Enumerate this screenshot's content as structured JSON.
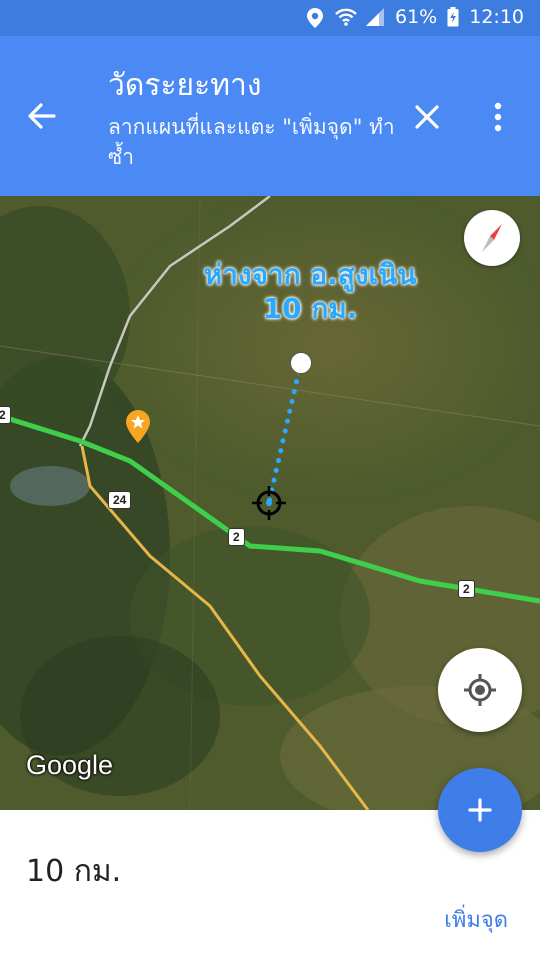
{
  "status_bar": {
    "battery": "61%",
    "time": "12:10",
    "icons": [
      "location-icon",
      "wifi-icon",
      "signal-icon",
      "battery-charging-icon"
    ]
  },
  "app_bar": {
    "title": "วัดระยะทาง",
    "subtitle": "ลากแผนที่และแตะ \"เพิ่มจุด\" ทำซ้ำ",
    "icons": [
      "back-arrow-icon",
      "close-icon",
      "more-vert-icon"
    ]
  },
  "map": {
    "distance_label_line1": "ห่างจาก อ.สูงเนิน",
    "distance_label_line2": "10 กม.",
    "road_shields": [
      "2",
      "24",
      "2",
      "2"
    ],
    "attribution": "Google",
    "icons": [
      "compass-icon",
      "my-location-icon",
      "place-star-icon",
      "crosshair-icon"
    ]
  },
  "bottom_panel": {
    "distance": "10 กม.",
    "add_point": "เพิ่มจุด",
    "fab_icon": "add-icon"
  },
  "colors": {
    "app_bar": "#4b8af5",
    "status_bar": "#3d7de0",
    "accent": "#3f7ee8",
    "measure_line": "#29a9ff",
    "highway": "#3fcf4a"
  }
}
